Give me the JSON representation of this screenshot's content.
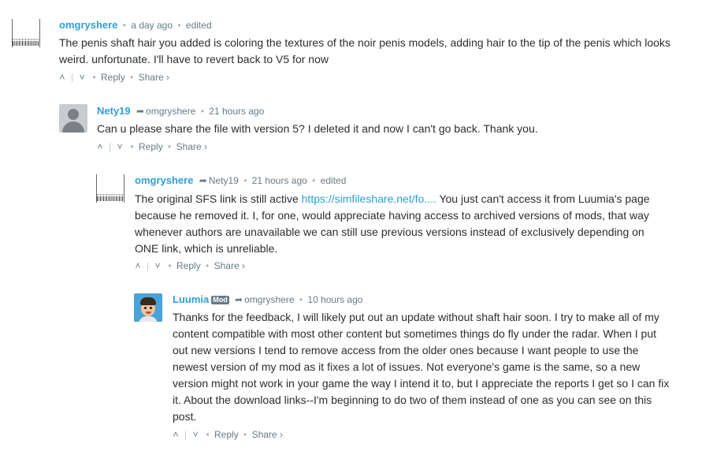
{
  "comments": [
    {
      "author": "omgryshere",
      "reply_to": "",
      "time": "a day ago",
      "edited": "edited",
      "body": "The penis shaft hair you added is coloring the textures of the noir penis models, adding hair to the tip of the penis which looks weird. unfortunate. I'll have to revert back to V5 for now",
      "avatar": "scribble-avatar"
    },
    {
      "author": "Nety19",
      "reply_to": "omgryshere",
      "time": "21 hours ago",
      "edited": "",
      "body": "Can u please share the file with version 5? I deleted it and now I can't go back. Thank you.",
      "avatar": "default-avatar"
    },
    {
      "author": "omgryshere",
      "reply_to": "Nety19",
      "time": "21 hours ago",
      "edited": "edited",
      "body_before": "The original SFS link is still active ",
      "link": "https://simfileshare.net/fo....",
      "body_after": " You just can't access it from Luumia's page because he removed it. I, for one, would appreciate having access to archived versions of mods, that way whenever authors are unavailable we can still use previous versions instead of exclusively depending on ONE link, which is unreliable.",
      "avatar": "scribble-avatar"
    },
    {
      "author": "Luumia",
      "badge": "Mod",
      "reply_to": "omgryshere",
      "time": "10 hours ago",
      "edited": "",
      "body": "Thanks for the feedback, I will likely put out an update without shaft hair soon. I try to make all of my content compatible with most other content but sometimes things do fly under the radar. When I put out new versions I tend to remove access from the older ones because I want people to use the newest version of my mod as it fixes a lot of issues. Not everyone's game is the same, so a new version might not work in your game the way I intend it to, but I appreciate the reports I get so I can fix it. About the download links--I'm beginning to do two of them instead of one as you can see on this post.",
      "avatar": "memoji-avatar"
    }
  ],
  "actions": {
    "upvote": "^",
    "downvote": "v",
    "reply": "Reply",
    "share": "Share ›"
  },
  "glyphs": {
    "bullet": "•",
    "reply_arrow": "➦"
  },
  "colors": {
    "author": "#2e9fd8",
    "meta": "#687a86",
    "text": "#2a2e2e",
    "link": "#2e9fd8"
  }
}
